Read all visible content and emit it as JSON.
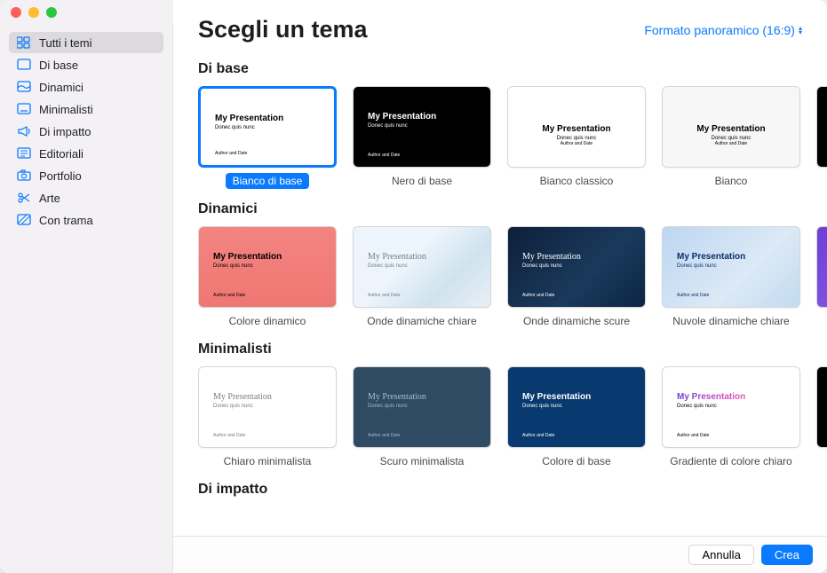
{
  "header": {
    "title": "Scegli un tema",
    "format": "Formato panoramico (16:9)"
  },
  "sidebar": {
    "items": [
      {
        "label": "Tutti i temi",
        "icon": "grid"
      },
      {
        "label": "Di base",
        "icon": "square"
      },
      {
        "label": "Dinamici",
        "icon": "dynamic"
      },
      {
        "label": "Minimalisti",
        "icon": "minimal"
      },
      {
        "label": "Di impatto",
        "icon": "megaphone"
      },
      {
        "label": "Editoriali",
        "icon": "newspaper"
      },
      {
        "label": "Portfolio",
        "icon": "camera"
      },
      {
        "label": "Arte",
        "icon": "scissors"
      },
      {
        "label": "Con trama",
        "icon": "texture"
      }
    ]
  },
  "preview": {
    "title": "My Presentation",
    "subtitle": "Donec quis nunc",
    "footer": "Author and Date"
  },
  "sections": [
    {
      "title": "Di base",
      "themes": [
        {
          "label": "Bianco di base",
          "cls": "bg-white",
          "selected": true
        },
        {
          "label": "Nero di base",
          "cls": "bg-black"
        },
        {
          "label": "Bianco classico",
          "cls": "bg-white",
          "centered": true
        },
        {
          "label": "Bianco",
          "cls": "bg-lightgray",
          "centered": true
        }
      ],
      "partial": "bg-black"
    },
    {
      "title": "Dinamici",
      "themes": [
        {
          "label": "Colore dinamico",
          "cls": "bg-coral"
        },
        {
          "label": "Onde dinamiche chiare",
          "cls": "bg-waveslight",
          "minf": true
        },
        {
          "label": "Onde dinamiche scure",
          "cls": "bg-wavesdark",
          "minf": true
        },
        {
          "label": "Nuvole dinamiche chiare",
          "cls": "bg-cloudslight"
        }
      ],
      "partial": "bg-cloudspurple"
    },
    {
      "title": "Minimalisti",
      "themes": [
        {
          "label": "Chiaro minimalista",
          "cls": "bg-minlight",
          "minf": true
        },
        {
          "label": "Scuro minimalista",
          "cls": "bg-mindark",
          "minf": true
        },
        {
          "label": "Colore di base",
          "cls": "bg-minblue"
        },
        {
          "label": "Gradiente di colore chiaro",
          "cls": "bg-grad",
          "grad": true
        }
      ],
      "partial": "bg-black"
    },
    {
      "title": "Di impatto",
      "themes": []
    }
  ],
  "footer": {
    "cancel": "Annulla",
    "create": "Crea"
  }
}
